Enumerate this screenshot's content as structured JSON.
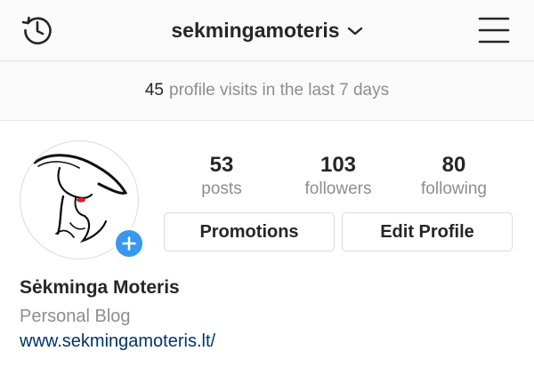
{
  "header": {
    "username": "sekmingamoteris",
    "icons": {
      "left": "history-clock-icon",
      "dropdown": "chevron-down-icon",
      "right": "hamburger-menu-icon"
    }
  },
  "insights": {
    "count": "45",
    "text": "profile visits in the last 7 days"
  },
  "profile": {
    "avatar_icon": "lady-in-hat-illustration",
    "add_icon": "plus-icon",
    "stats": [
      {
        "value": "53",
        "label": "posts"
      },
      {
        "value": "103",
        "label": "followers"
      },
      {
        "value": "80",
        "label": "following"
      }
    ],
    "buttons": {
      "promotions": "Promotions",
      "edit_profile": "Edit Profile"
    }
  },
  "bio": {
    "name": "Sėkminga Moteris",
    "category": "Personal Blog",
    "link": "www.sekmingamoteris.lt/"
  },
  "colors": {
    "accent_blue": "#3897f0",
    "link": "#003569",
    "muted_text": "#8e8e8e",
    "primary_text": "#262626",
    "border": "#dbdbdb",
    "lip_red": "#d21e2b"
  }
}
